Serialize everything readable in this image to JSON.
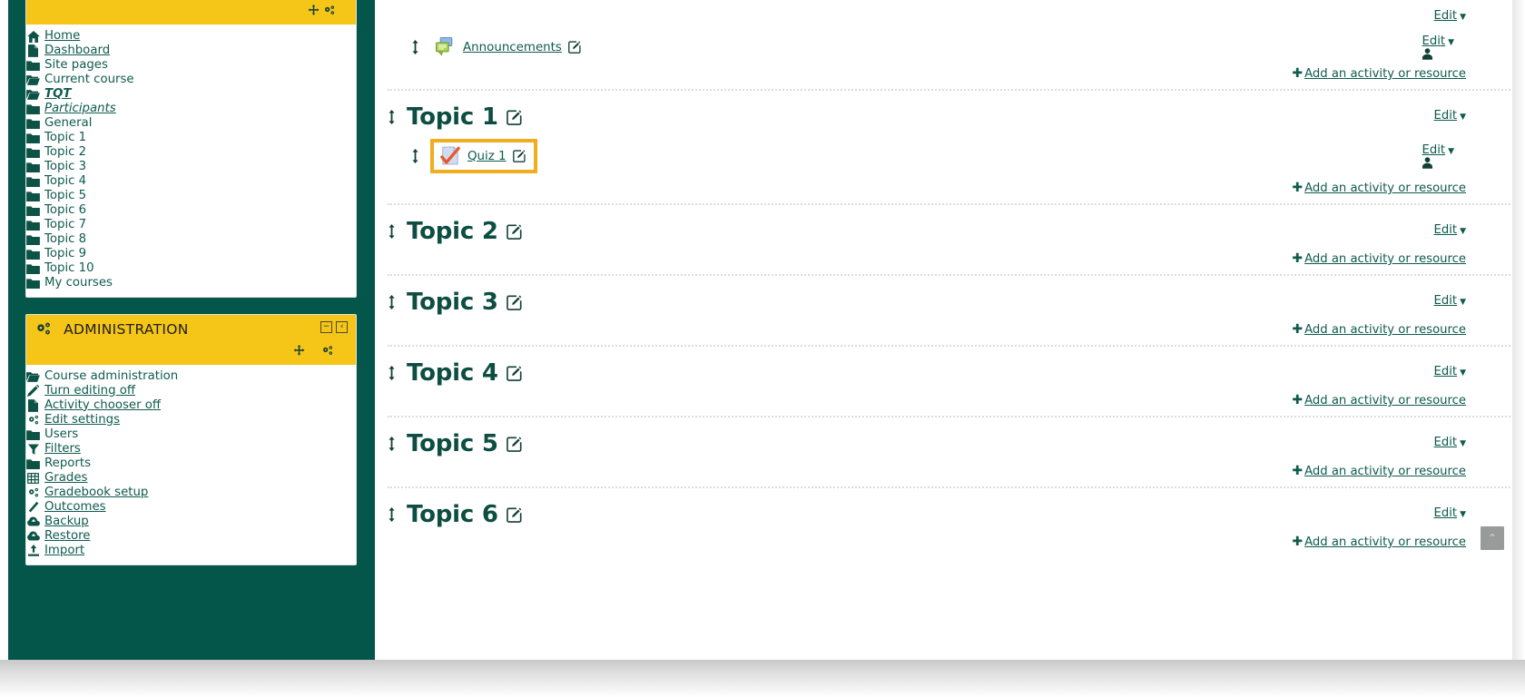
{
  "theme": {
    "page_bg": "#04564a",
    "block_header_bg": "#f5c518",
    "link_color": "#0f5b4f",
    "heading_color": "#0d4d42",
    "highlight_border": "#f0ad1f",
    "scrolltop_bg": "#999a9a"
  },
  "navigation_block": {
    "header_icons": [
      "move-icon",
      "block-settings-icon"
    ],
    "items": [
      {
        "label": "Home",
        "icon": "home-icon",
        "depth": 0,
        "style": "link"
      },
      {
        "label": "Dashboard",
        "icon": "page-icon",
        "depth": 1,
        "style": "link"
      },
      {
        "label": "Site pages",
        "icon": "folder-icon",
        "depth": 0,
        "style": "plain"
      },
      {
        "label": "Current course",
        "icon": "folder-open-icon",
        "depth": 0,
        "style": "plain"
      },
      {
        "label": "TQT",
        "icon": "folder-open-icon",
        "depth": 1,
        "style": "italic"
      },
      {
        "label": "Participants",
        "icon": "folder-icon",
        "depth": 2,
        "style": "italic-plain"
      },
      {
        "label": "General",
        "icon": "folder-icon",
        "depth": 2,
        "style": "plain"
      },
      {
        "label": "Topic 1",
        "icon": "folder-icon",
        "depth": 2,
        "style": "plain"
      },
      {
        "label": "Topic 2",
        "icon": "folder-icon",
        "depth": 2,
        "style": "plain"
      },
      {
        "label": "Topic 3",
        "icon": "folder-icon",
        "depth": 2,
        "style": "plain"
      },
      {
        "label": "Topic 4",
        "icon": "folder-icon",
        "depth": 2,
        "style": "plain"
      },
      {
        "label": "Topic 5",
        "icon": "folder-icon",
        "depth": 2,
        "style": "plain"
      },
      {
        "label": "Topic 6",
        "icon": "folder-icon",
        "depth": 2,
        "style": "plain"
      },
      {
        "label": "Topic 7",
        "icon": "folder-icon",
        "depth": 2,
        "style": "plain"
      },
      {
        "label": "Topic 8",
        "icon": "folder-icon",
        "depth": 2,
        "style": "plain"
      },
      {
        "label": "Topic 9",
        "icon": "folder-icon",
        "depth": 2,
        "style": "plain"
      },
      {
        "label": "Topic 10",
        "icon": "folder-icon",
        "depth": 2,
        "style": "plain"
      },
      {
        "label": "My courses",
        "icon": "folder-icon",
        "depth": 0,
        "style": "plain"
      }
    ]
  },
  "administration_block": {
    "title": "ADMINISTRATION",
    "header_lead_icon": "gears-icon",
    "collapse_label": "−",
    "dock_label": "‹",
    "action_icons": [
      "move-icon",
      "block-settings-icon"
    ],
    "items": [
      {
        "label": "Course administration",
        "icon": "folder-open-icon",
        "depth": 0,
        "style": "plain"
      },
      {
        "label": "Turn editing off",
        "icon": "pencil-icon",
        "depth": 1,
        "style": "link"
      },
      {
        "label": "Activity chooser off",
        "icon": "page-icon",
        "depth": 1,
        "style": "link"
      },
      {
        "label": "Edit settings",
        "icon": "gears-icon",
        "depth": 1,
        "style": "link"
      },
      {
        "label": "Users",
        "icon": "folder-icon",
        "depth": 1,
        "style": "plain"
      },
      {
        "label": "Filters",
        "icon": "filter-icon",
        "depth": 1,
        "style": "link"
      },
      {
        "label": "Reports",
        "icon": "folder-icon",
        "depth": 1,
        "style": "plain"
      },
      {
        "label": "Grades",
        "icon": "table-icon",
        "depth": 1,
        "style": "link"
      },
      {
        "label": "Gradebook setup",
        "icon": "gears-icon",
        "depth": 1,
        "style": "link"
      },
      {
        "label": "Outcomes",
        "icon": "pen-icon",
        "depth": 1,
        "style": "link"
      },
      {
        "label": "Backup",
        "icon": "cloud-icon",
        "depth": 1,
        "style": "link"
      },
      {
        "label": "Restore",
        "icon": "cloud-icon",
        "depth": 1,
        "style": "link"
      },
      {
        "label": "Import",
        "icon": "upload-icon",
        "depth": 1,
        "style": "link"
      }
    ]
  },
  "course": {
    "edit_label": "Edit",
    "add_activity_label": "Add an activity or resource",
    "sections": [
      {
        "title": null,
        "has_section_edit": true,
        "activities": [
          {
            "name": "Announcements",
            "icon": "forum-icon",
            "highlighted": false,
            "has_person": true
          }
        ]
      },
      {
        "title": "Topic 1",
        "has_section_edit": true,
        "activities": [
          {
            "name": "Quiz 1",
            "icon": "quiz-icon",
            "highlighted": true,
            "has_person": true
          }
        ]
      },
      {
        "title": "Topic 2",
        "has_section_edit": true,
        "activities": []
      },
      {
        "title": "Topic 3",
        "has_section_edit": true,
        "activities": []
      },
      {
        "title": "Topic 4",
        "has_section_edit": true,
        "activities": []
      },
      {
        "title": "Topic 5",
        "has_section_edit": true,
        "activities": []
      },
      {
        "title": "Topic 6",
        "has_section_edit": true,
        "activities": []
      }
    ]
  },
  "scroll_to_top": {
    "label": "⌃"
  }
}
